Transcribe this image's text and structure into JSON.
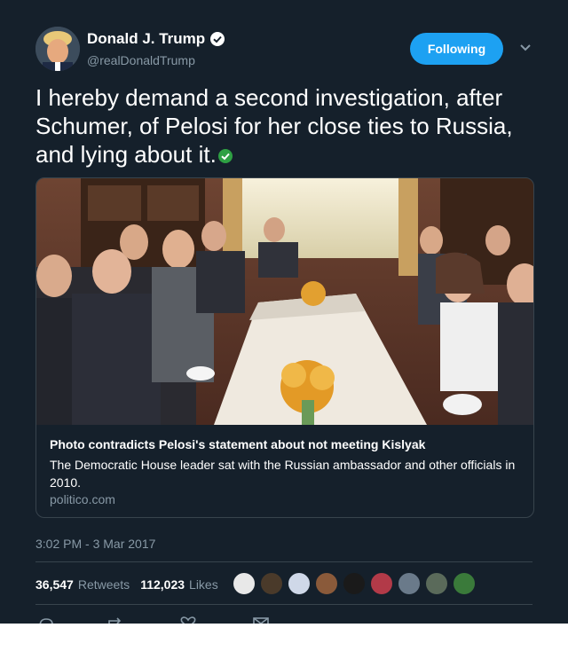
{
  "user": {
    "display_name": "Donald J. Trump",
    "handle": "@realDonaldTrump",
    "follow_label": "Following"
  },
  "tweet": {
    "text": "I hereby demand a second investigation, after Schumer, of Pelosi for her close ties to Russia, and lying about it."
  },
  "link_card": {
    "title": "Photo contradicts Pelosi's statement about not meeting Kislyak",
    "description": "The Democratic House leader sat with the Russian ambassador and other officials in 2010.",
    "domain": "politico.com"
  },
  "meta": {
    "timestamp": "3:02 PM - 3 Mar 2017"
  },
  "stats": {
    "retweets_count": "36,547",
    "retweets_label": "Retweets",
    "likes_count": "112,023",
    "likes_label": "Likes"
  },
  "colors": {
    "background": "#15202b",
    "accent": "#1da1f2",
    "muted": "#8899a6",
    "border": "#38444d"
  }
}
